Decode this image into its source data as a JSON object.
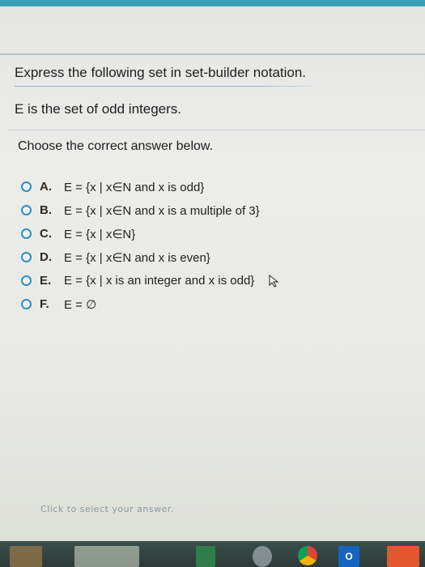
{
  "question": {
    "prompt": "Express the following set in set-builder notation.",
    "set_description": "E is the set of odd integers."
  },
  "instruction": "Choose the correct answer below.",
  "options": [
    {
      "letter": "A.",
      "text": "E = {x | x∈N and x is odd}"
    },
    {
      "letter": "B.",
      "text": "E = {x | x∈N and x is a multiple of 3}"
    },
    {
      "letter": "C.",
      "text": "E = {x | x∈N}"
    },
    {
      "letter": "D.",
      "text": "E = {x | x∈N and x is even}"
    },
    {
      "letter": "E.",
      "text": "E = {x | x is an integer and x is odd}"
    },
    {
      "letter": "F.",
      "text": "E = ∅"
    }
  ],
  "footer_hint": "Click to select your answer.",
  "taskbar": {
    "outlook_label": "O"
  },
  "colors": {
    "radio_border": "#2f8fc6",
    "accent_line": "#8bb0c8"
  }
}
